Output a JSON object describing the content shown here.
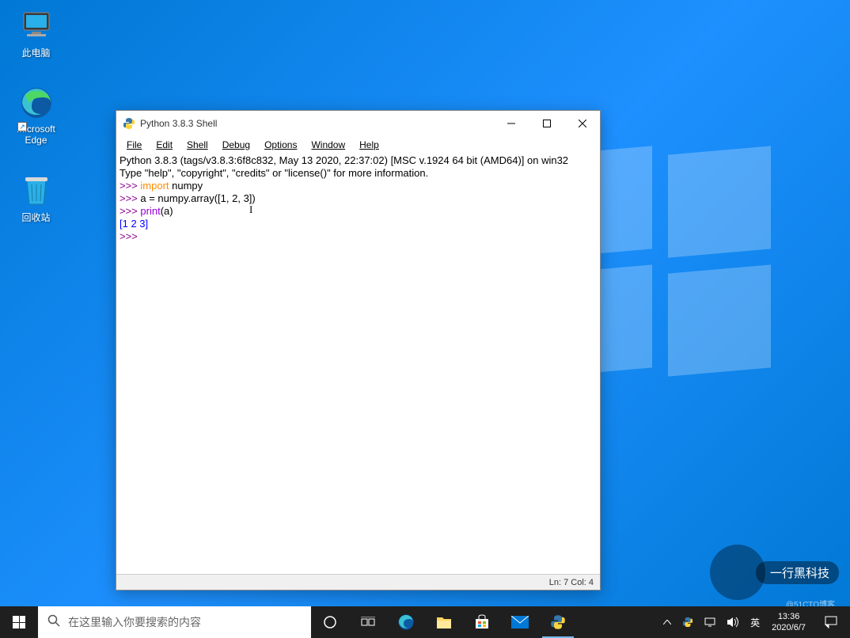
{
  "desktop": {
    "thispc": {
      "label": "此电脑"
    },
    "edge": {
      "label": "Microsoft Edge"
    },
    "recycle": {
      "label": "回收站"
    }
  },
  "idle": {
    "title": "Python 3.8.3 Shell",
    "menu": {
      "file": "File",
      "edit": "Edit",
      "shell": "Shell",
      "debug": "Debug",
      "options": "Options",
      "window": "Window",
      "help": "Help"
    },
    "content": {
      "line1": "Python 3.8.3 (tags/v3.8.3:6f8c832, May 13 2020, 22:37:02) [MSC v.1924 64 bit (AMD64)] on win32",
      "line2": "Type \"help\", \"copyright\", \"credits\" or \"license()\" for more information.",
      "prompt": ">>> ",
      "kw_import": "import",
      "txt_numpy": " numpy",
      "line4": "a = numpy.array([1, 2, 3])",
      "bi_print": "print",
      "line5_arg": "(a)",
      "output": "[1 2 3]"
    },
    "status": "Ln: 7  Col: 4"
  },
  "taskbar": {
    "search_placeholder": "在这里输入你要搜索的内容",
    "ime": "英",
    "time": "13:36",
    "date": "2020/6/7"
  },
  "watermark": {
    "text": "一行黑科技",
    "sub": "@51CTO博客"
  }
}
